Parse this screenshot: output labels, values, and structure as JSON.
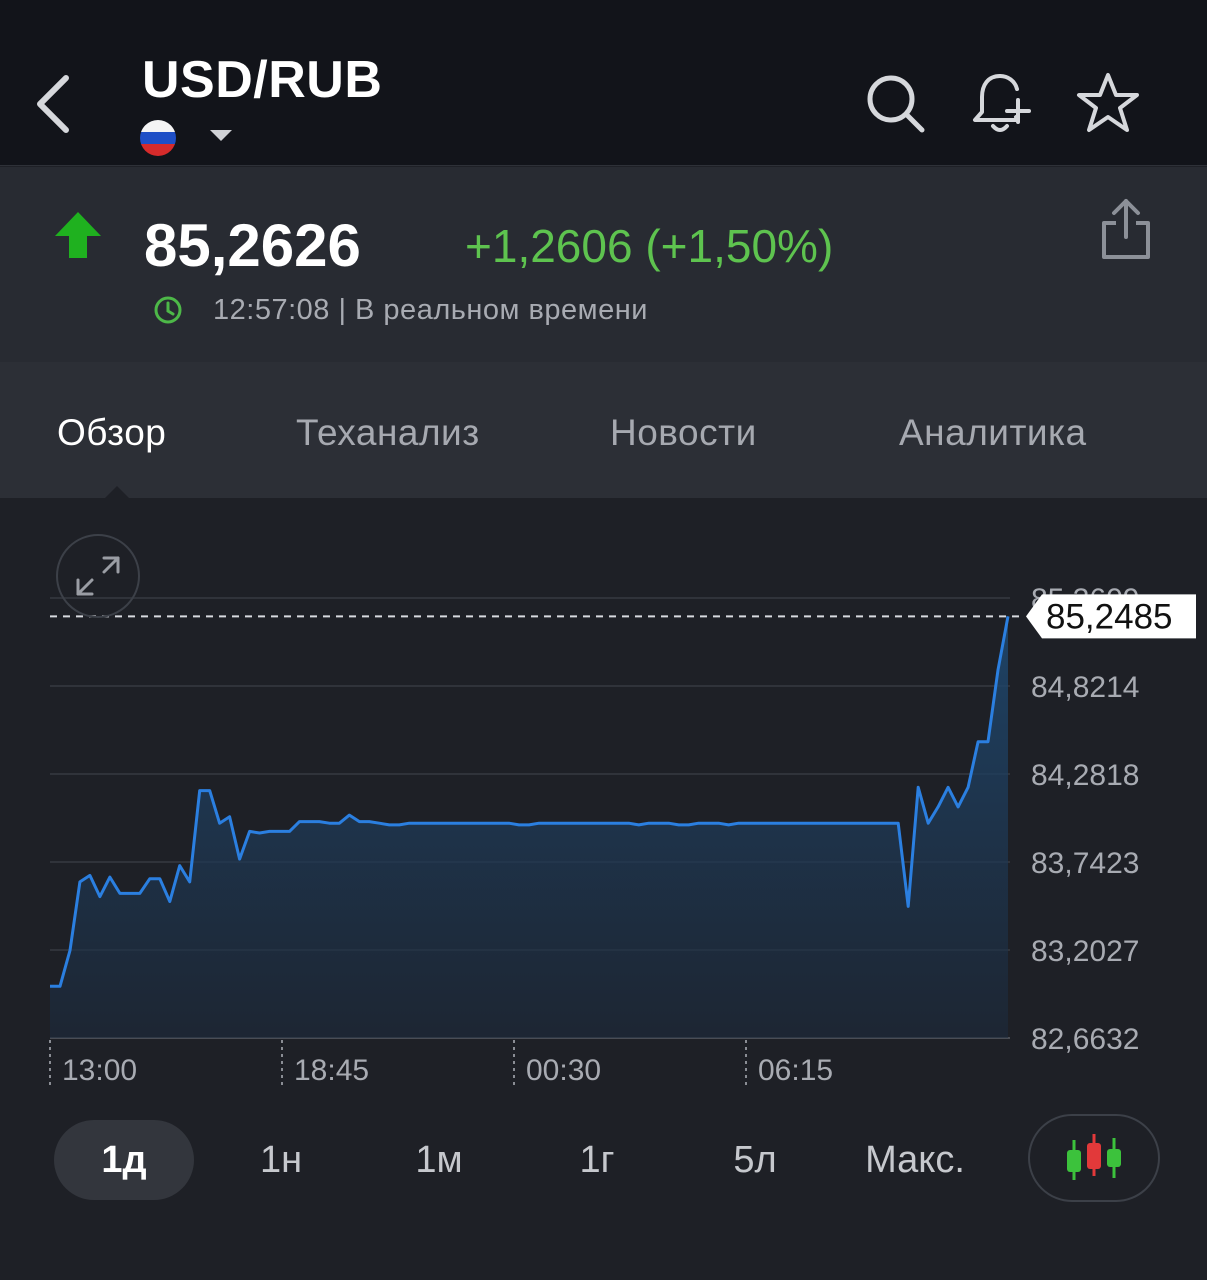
{
  "header": {
    "title": "USD/RUB",
    "icons": [
      "back-icon",
      "search-icon",
      "bell-plus-icon",
      "star-icon"
    ],
    "flag": "russia-flag-icon"
  },
  "quote": {
    "price": "85,2626",
    "change": "+1,2606 (+1,50%)",
    "time_status": "12:57:08 | В реальном времени",
    "direction": "up",
    "colors": {
      "up": "#1fb11f",
      "change_text": "#5ec34f"
    }
  },
  "tabs": [
    {
      "label": "Обзор",
      "active": true
    },
    {
      "label": "Теханализ",
      "active": false
    },
    {
      "label": "Новости",
      "active": false
    },
    {
      "label": "Аналитика",
      "active": false
    }
  ],
  "chart_data": {
    "type": "area",
    "y_ticks": [
      "85,3609",
      "84,8214",
      "84,2818",
      "83,7423",
      "83,2027",
      "82,6632"
    ],
    "y_tick_values": [
      85.3609,
      84.8214,
      84.2818,
      83.7423,
      83.2027,
      82.6632
    ],
    "x_ticks": [
      "13:00",
      "18:45",
      "00:30",
      "06:15"
    ],
    "ylim": [
      82.6632,
      85.3609
    ],
    "current_value": 85.2485,
    "current_label": "85,2485",
    "line_color": "#2b7fe0",
    "grid": true,
    "values": [
      82.98,
      82.98,
      83.2,
      83.62,
      83.66,
      83.53,
      83.65,
      83.55,
      83.55,
      83.55,
      83.64,
      83.64,
      83.5,
      83.72,
      83.62,
      84.18,
      84.18,
      83.98,
      84.02,
      83.76,
      83.93,
      83.92,
      83.93,
      83.93,
      83.93,
      83.99,
      83.99,
      83.99,
      83.98,
      83.98,
      84.03,
      83.99,
      83.99,
      83.98,
      83.97,
      83.97,
      83.98,
      83.98,
      83.98,
      83.98,
      83.98,
      83.98,
      83.98,
      83.98,
      83.98,
      83.98,
      83.98,
      83.97,
      83.97,
      83.98,
      83.98,
      83.98,
      83.98,
      83.98,
      83.98,
      83.98,
      83.98,
      83.98,
      83.98,
      83.97,
      83.98,
      83.98,
      83.98,
      83.97,
      83.97,
      83.98,
      83.98,
      83.98,
      83.97,
      83.98,
      83.98,
      83.98,
      83.98,
      83.98,
      83.98,
      83.98,
      83.98,
      83.98,
      83.98,
      83.98,
      83.98,
      83.98,
      83.98,
      83.98,
      83.98,
      83.98,
      83.47,
      84.2,
      83.98,
      84.08,
      84.2,
      84.08,
      84.2,
      84.48,
      84.48,
      84.92,
      85.2485
    ]
  },
  "ranges": [
    {
      "label": "1д",
      "active": true
    },
    {
      "label": "1н",
      "active": false
    },
    {
      "label": "1м",
      "active": false
    },
    {
      "label": "1г",
      "active": false
    },
    {
      "label": "5л",
      "active": false
    },
    {
      "label": "Макс.",
      "active": false
    }
  ]
}
